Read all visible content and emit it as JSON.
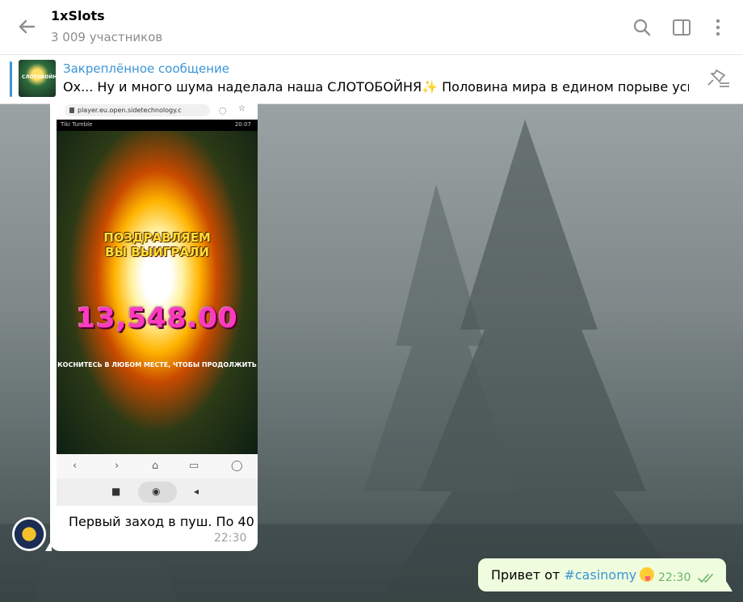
{
  "header": {
    "title": "1xSlots",
    "subtitle": "3 009 участников"
  },
  "pinned": {
    "title": "Закреплённое сообщение",
    "text": "Ох... Ну и много шума наделала наша СЛОТОБОЙНЯ✨  Половина мира в едином порыве усиле…",
    "thumb_text": "СЛОТОБОЙНЯ"
  },
  "screenshot": {
    "url": "player.eu.open.sidetechnology.c",
    "game_name": "Tiki Tumble",
    "clock": "20:07",
    "congrats_line1": "ПОЗДРАВЛЯЕМ",
    "congrats_line2": "ВЫ ВЫИГРАЛИ",
    "win_amount": "13,548.00",
    "hint": "КОСНИТЕСЬ В ЛЮБОМ МЕСТЕ, ЧТОБЫ ПРОДОЛЖИТЬ"
  },
  "messages": {
    "incoming_text": "Первый заход в пуш. По 40",
    "incoming_time": "22:30",
    "outgoing_prefix": "Привет от ",
    "outgoing_hashtag": "#casinomy",
    "outgoing_time": "22:30"
  },
  "icons": {
    "back": "arrow-left-icon",
    "search": "search-icon",
    "sidebar": "sidebar-toggle-icon",
    "more": "more-vertical-icon",
    "unpin": "unpin-icon",
    "read": "double-check-icon"
  },
  "colors": {
    "accent": "#3a94d6",
    "outgoing_bubble": "#effdde",
    "incoming_bubble": "#ffffff"
  }
}
